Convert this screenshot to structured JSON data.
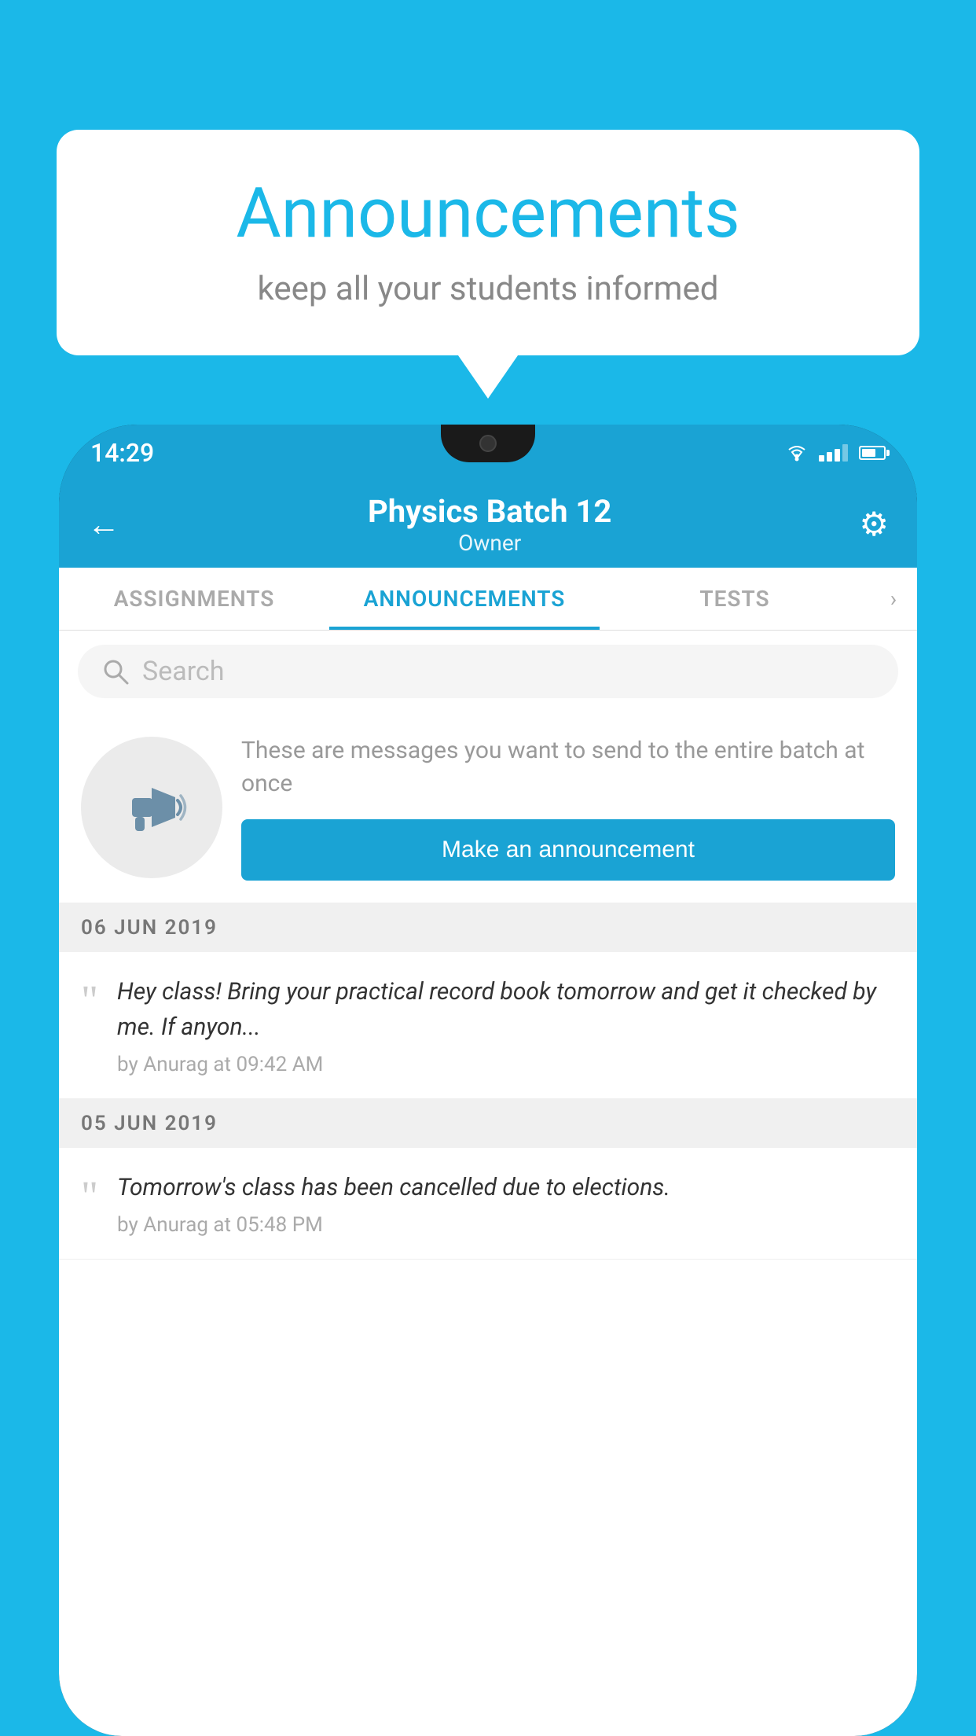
{
  "background_color": "#1bb8e8",
  "speech_bubble": {
    "title": "Announcements",
    "subtitle": "keep all your students informed"
  },
  "phone": {
    "status_bar": {
      "time": "14:29"
    },
    "header": {
      "title": "Physics Batch 12",
      "subtitle": "Owner",
      "back_label": "←",
      "gear_label": "⚙"
    },
    "tabs": [
      {
        "label": "ASSIGNMENTS",
        "active": false
      },
      {
        "label": "ANNOUNCEMENTS",
        "active": true
      },
      {
        "label": "TESTS",
        "active": false
      }
    ],
    "search": {
      "placeholder": "Search"
    },
    "promo": {
      "description": "These are messages you want to send to the entire batch at once",
      "button_label": "Make an announcement"
    },
    "announcement_groups": [
      {
        "date": "06  JUN  2019",
        "items": [
          {
            "text": "Hey class! Bring your practical record book tomorrow and get it checked by me. If anyon...",
            "meta": "by Anurag at 09:42 AM"
          }
        ]
      },
      {
        "date": "05  JUN  2019",
        "items": [
          {
            "text": "Tomorrow's class has been cancelled due to elections.",
            "meta": "by Anurag at 05:48 PM"
          }
        ]
      }
    ]
  }
}
